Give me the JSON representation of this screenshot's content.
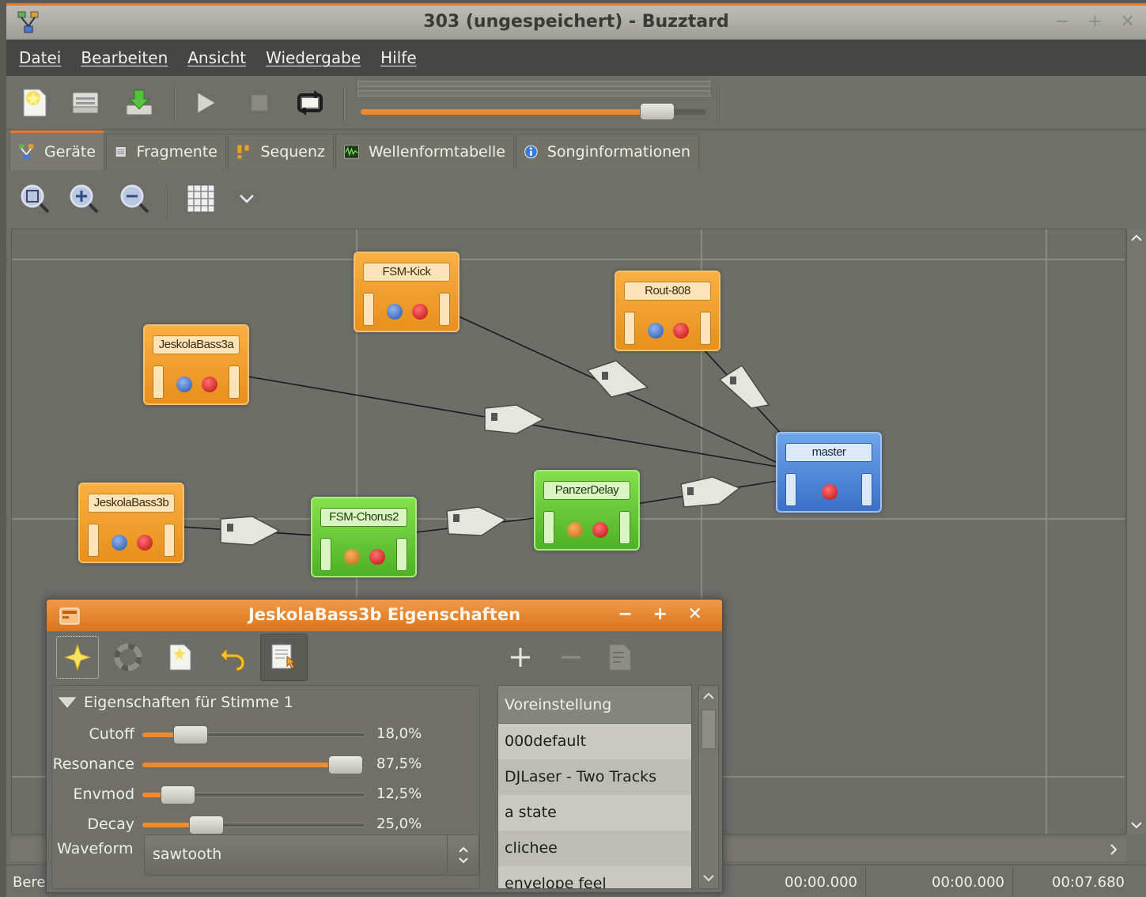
{
  "window": {
    "title": "303 (ungespeichert) - Buzztard",
    "controls": "− + ✕"
  },
  "menu": [
    "Datei",
    "Bearbeiten",
    "Ansicht",
    "Wiedergabe",
    "Hilfe"
  ],
  "tabs": [
    {
      "label": "Geräte",
      "icon": "machines-icon"
    },
    {
      "label": "Fragmente",
      "icon": "pattern-icon"
    },
    {
      "label": "Sequenz",
      "icon": "sequence-icon"
    },
    {
      "label": "Wellenformtabelle",
      "icon": "waveform-icon"
    },
    {
      "label": "Songinformationen",
      "icon": "info-icon"
    }
  ],
  "volume": {
    "level": 0.9
  },
  "machines": [
    {
      "name": "FSM-Kick",
      "color": "#ec9a24"
    },
    {
      "name": "Rout-808",
      "color": "#ec9a24"
    },
    {
      "name": "JeskolaBass3a",
      "color": "#ec9a24"
    },
    {
      "name": "master",
      "color": "#4b80d4"
    },
    {
      "name": "JeskolaBass3b",
      "color": "#ec9a24"
    },
    {
      "name": "FSM-Chorus2",
      "color": "#62c030"
    },
    {
      "name": "PanzerDelay",
      "color": "#62c030"
    }
  ],
  "status": {
    "left": "Bere",
    "time1": "00:00.000",
    "time2": "00:00.000",
    "time3": "00:07.680"
  },
  "dialog": {
    "title": "JeskolaBass3b Eigenschaften",
    "controls": "− + ✕",
    "section": "Eigenschaften für Stimme 1",
    "params": [
      {
        "name": "Cutoff",
        "value": "18,0%",
        "level": 0.18
      },
      {
        "name": "Resonance",
        "value": "87,5%",
        "level": 0.875
      },
      {
        "name": "Envmod",
        "value": "12,5%",
        "level": 0.125
      },
      {
        "name": "Decay",
        "value": "25,0%",
        "level": 0.25
      }
    ],
    "waveform_label": "Waveform",
    "waveform_value": "sawtooth",
    "presets_header": "Voreinstellung",
    "presets": [
      "000default",
      "DJLaser - Two Tracks",
      "a state",
      "clichee",
      "envelope feel"
    ]
  },
  "colors": {
    "accent": "#e07a2a",
    "orange_machine": "#ec9a24",
    "green_machine": "#62c030",
    "blue_machine": "#4b80d4"
  }
}
